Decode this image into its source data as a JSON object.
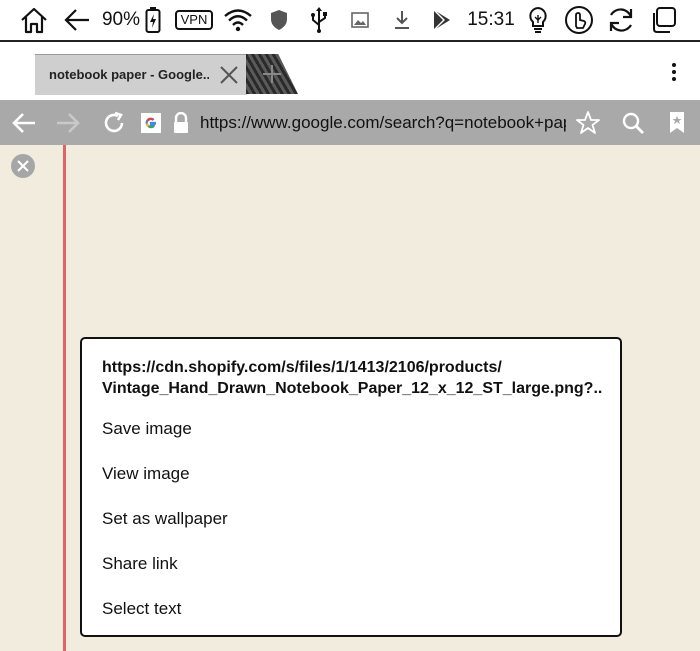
{
  "status_bar": {
    "battery_percent": "90%",
    "vpn_label": "VPN",
    "time": "15:31",
    "icons": [
      "home-icon",
      "back-arrow-icon",
      "battery-charging-icon",
      "wifi-icon",
      "shield-icon",
      "usb-icon",
      "image-icon",
      "download-icon",
      "play-store-icon",
      "bulb-icon",
      "touch-icon",
      "refresh-icon",
      "multi-window-icon"
    ]
  },
  "tab": {
    "title": "notebook paper - Google..."
  },
  "toolbar": {
    "url": "https://www.google.com/search?q=notebook+paper"
  },
  "context_menu": {
    "url_line1": "https://cdn.shopify.com/s/files/1/1413/2106/products/",
    "url_line2": "Vintage_Hand_Drawn_Notebook_Paper_12_x_12_ST_large.png?...",
    "items": [
      "Save image",
      "View image",
      "Set as wallpaper",
      "Share link",
      "Select text"
    ]
  },
  "colors": {
    "toolbar_bg": "#a9a9a9",
    "paper_bg": "#f1ecde",
    "rule_line": "#62c0e7",
    "margin_line": "#e0636b"
  }
}
